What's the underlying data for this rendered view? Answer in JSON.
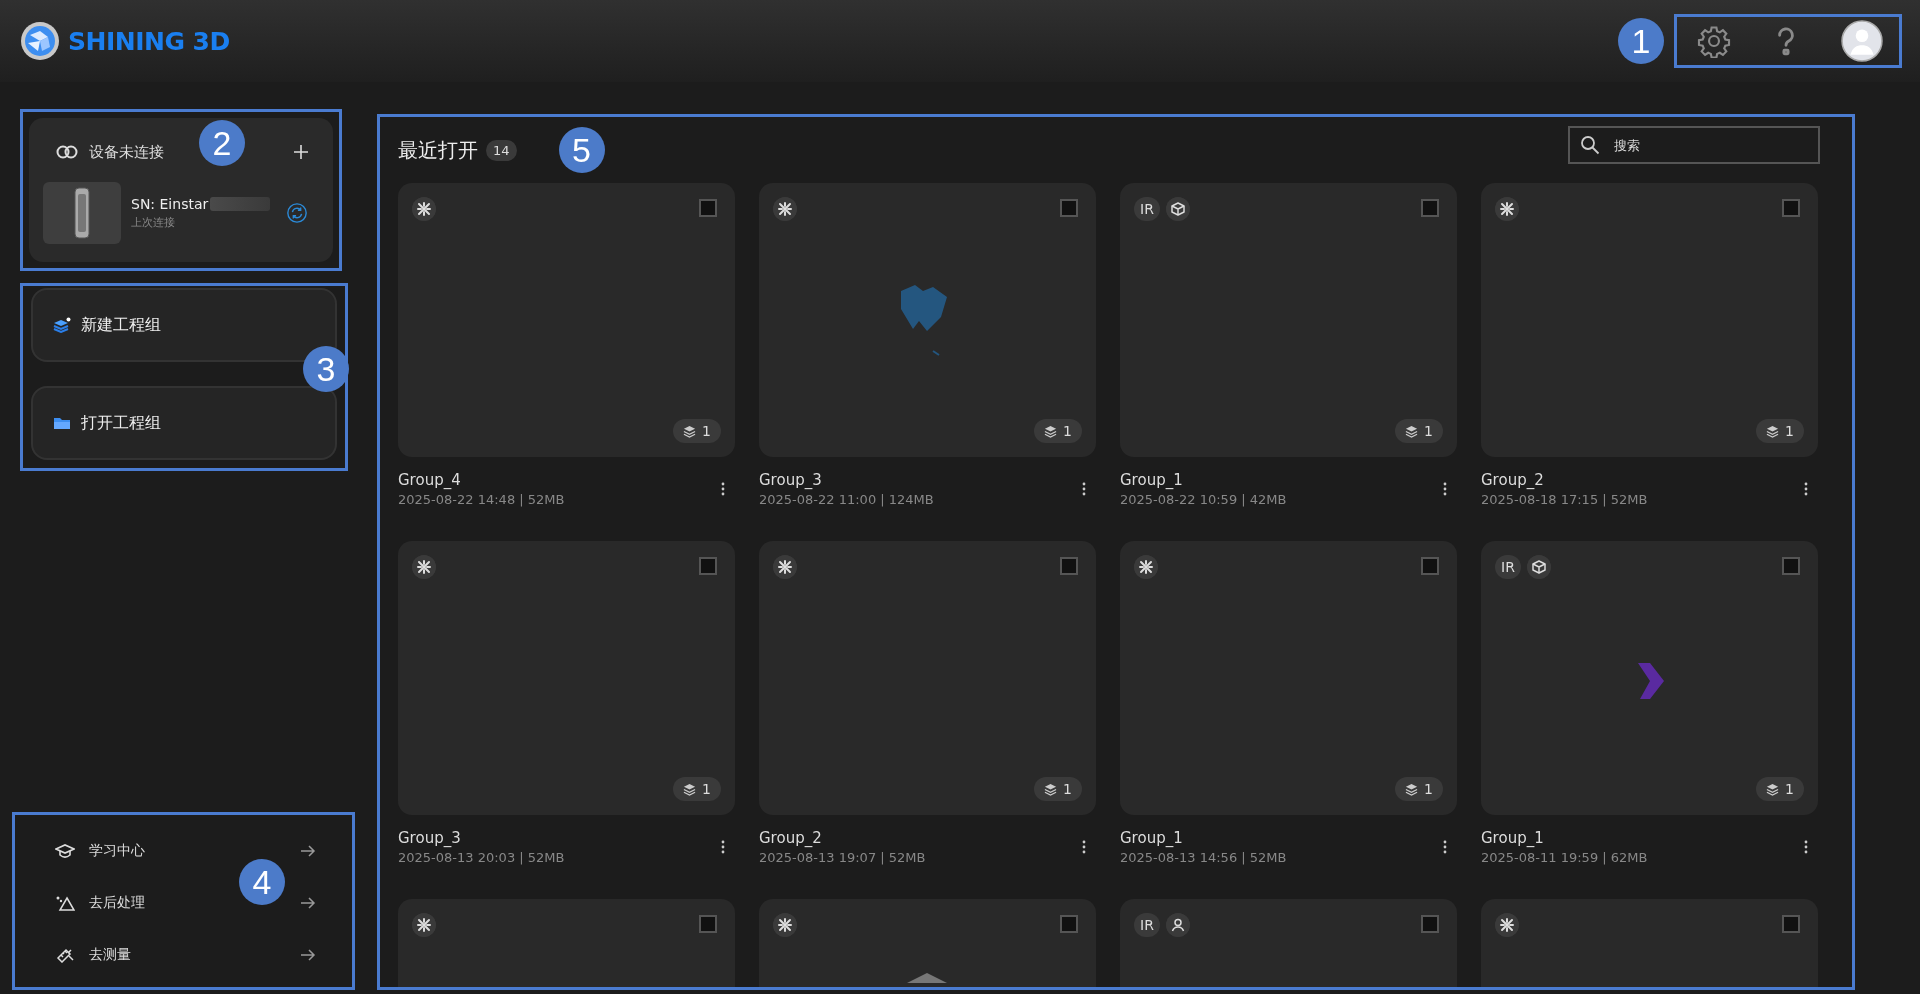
{
  "header": {
    "logo_text": "SHINING 3D",
    "annotation": "1"
  },
  "device": {
    "annotation": "2",
    "status": "设备未连接",
    "sn": "SN: Einstar",
    "last_connected": "上次连接"
  },
  "actions": {
    "annotation": "3",
    "items": [
      {
        "kind": "new",
        "label": "新建工程组"
      },
      {
        "kind": "open",
        "label": "打开工程组"
      }
    ]
  },
  "links": {
    "annotation": "4",
    "items": [
      {
        "kind": "learn",
        "label": "学习中心"
      },
      {
        "kind": "process",
        "label": "去后处理"
      },
      {
        "kind": "measure",
        "label": "去测量"
      }
    ]
  },
  "recent": {
    "annotation": "5",
    "title": "最近打开",
    "count": "14",
    "search": {
      "placeholder": "搜索"
    },
    "projects": [
      {
        "name": "Group_4",
        "meta": "2025-08-22 14:48 | 52MB",
        "tags": [
          {
            "kind": "fusion"
          }
        ],
        "layers": "1",
        "checked": false
      },
      {
        "name": "Group_3",
        "meta": "2025-08-22 11:00 | 124MB",
        "tags": [
          {
            "kind": "fusion"
          }
        ],
        "layers": "1",
        "checked": false,
        "preview": {
          "kind": "scan",
          "color": "#24567f"
        }
      },
      {
        "name": "Group_1",
        "meta": "2025-08-22 10:59 | 42MB",
        "tags": [
          {
            "kind": "text",
            "text": "IR"
          },
          {
            "kind": "object"
          }
        ],
        "layers": "1",
        "checked": false
      },
      {
        "name": "Group_2",
        "meta": "2025-08-18 17:15 | 52MB",
        "tags": [
          {
            "kind": "fusion"
          }
        ],
        "layers": "1",
        "checked": false
      },
      {
        "name": "Group_3",
        "meta": "2025-08-13 20:03 | 52MB",
        "tags": [
          {
            "kind": "fusion"
          }
        ],
        "layers": "1",
        "checked": false
      },
      {
        "name": "Group_2",
        "meta": "2025-08-13 19:07 | 52MB",
        "tags": [
          {
            "kind": "fusion"
          }
        ],
        "layers": "1",
        "checked": false
      },
      {
        "name": "Group_1",
        "meta": "2025-08-13 14:56 | 52MB",
        "tags": [
          {
            "kind": "fusion"
          }
        ],
        "layers": "1",
        "checked": false
      },
      {
        "name": "Group_1",
        "meta": "2025-08-11 19:59 | 62MB",
        "tags": [
          {
            "kind": "text",
            "text": "IR"
          },
          {
            "kind": "object"
          }
        ],
        "layers": "1",
        "checked": false,
        "preview": {
          "kind": "chevron",
          "color": "#5a2aa0"
        }
      },
      {
        "tags": [
          {
            "kind": "fusion"
          }
        ],
        "checked": false
      },
      {
        "tags": [
          {
            "kind": "fusion"
          }
        ],
        "checked": false
      },
      {
        "tags": [
          {
            "kind": "text",
            "text": "IR"
          },
          {
            "kind": "person"
          }
        ],
        "checked": false
      },
      {
        "tags": [
          {
            "kind": "fusion"
          }
        ],
        "checked": false
      }
    ]
  }
}
